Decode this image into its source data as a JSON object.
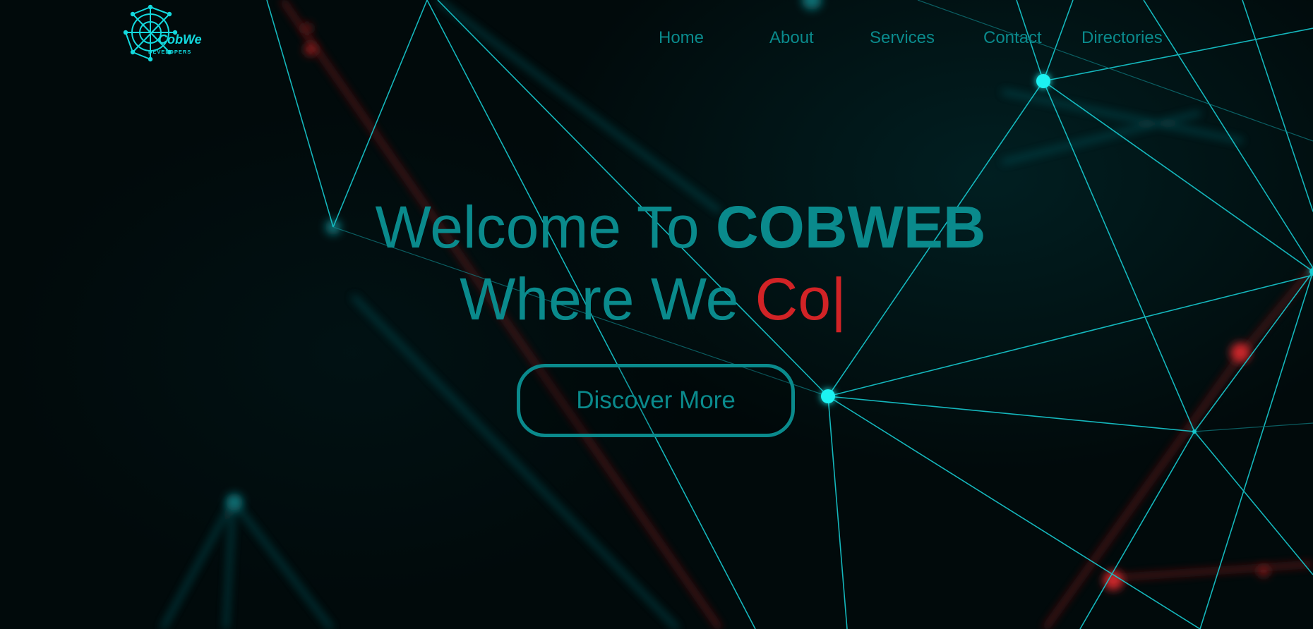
{
  "brand": {
    "logo_text_main": "CobWeb",
    "logo_text_sub": "DEVELOPERS"
  },
  "nav": {
    "items": [
      {
        "label": "Home"
      },
      {
        "label": "About"
      },
      {
        "label": "Services"
      },
      {
        "label": "Contact"
      },
      {
        "label": "Directories"
      }
    ]
  },
  "hero": {
    "line1_prefix": "Welcome To ",
    "line1_brand": "COBWEB",
    "line2_prefix": "Where We ",
    "line2_typed": "Co",
    "cursor": "|",
    "cta_label": "Discover More"
  },
  "colors": {
    "accent": "#0a8a8c",
    "highlight": "#d22326",
    "node_cyan": "#1ff2f2",
    "background": "#010a0b"
  }
}
